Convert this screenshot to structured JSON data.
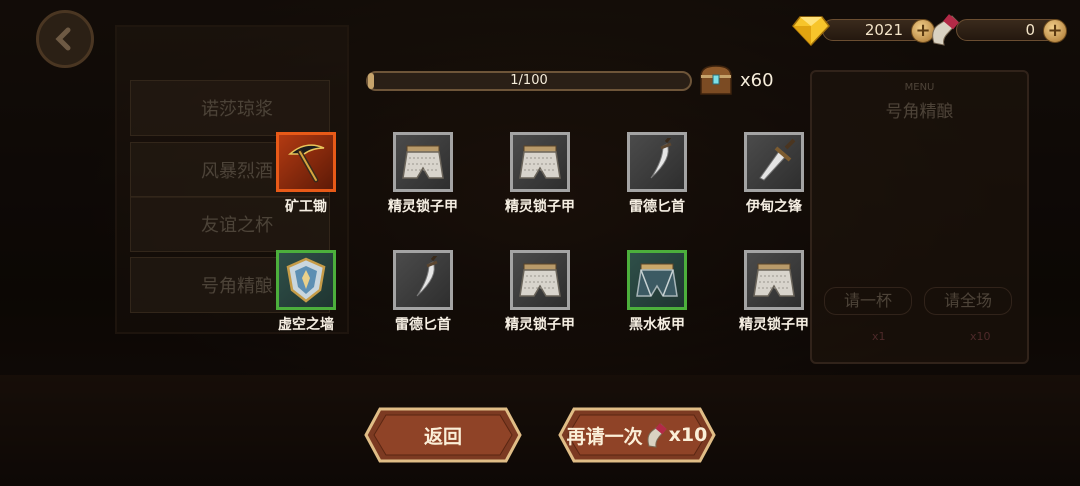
{
  "currency": {
    "gems": {
      "icon": "diamond-icon",
      "value": "2021"
    },
    "horns": {
      "icon": "horn-icon",
      "value": "0"
    }
  },
  "progress": {
    "text": "1/100",
    "fraction": 0.01
  },
  "chest": {
    "icon": "treasure-chest-icon",
    "count": "x60"
  },
  "items": [
    {
      "name": "矿工锄",
      "icon": "pickaxe-icon",
      "rarity": "orange"
    },
    {
      "name": "精灵锁子甲",
      "icon": "chainmail-skirt-icon",
      "rarity": "grey"
    },
    {
      "name": "精灵锁子甲",
      "icon": "chainmail-skirt-icon",
      "rarity": "grey"
    },
    {
      "name": "雷德匕首",
      "icon": "curved-dagger-icon",
      "rarity": "grey"
    },
    {
      "name": "伊甸之锋",
      "icon": "blade-icon",
      "rarity": "grey"
    },
    {
      "name": "虚空之墙",
      "icon": "shield-icon",
      "rarity": "green"
    },
    {
      "name": "雷德匕首",
      "icon": "curved-dagger-icon",
      "rarity": "grey"
    },
    {
      "name": "精灵锁子甲",
      "icon": "chainmail-skirt-icon",
      "rarity": "grey"
    },
    {
      "name": "黑水板甲",
      "icon": "plate-skirt-icon",
      "rarity": "green"
    },
    {
      "name": "精灵锁子甲",
      "icon": "chainmail-skirt-icon",
      "rarity": "grey"
    }
  ],
  "buttons": {
    "back": "返回",
    "again": "再请一次",
    "again_cost": "x10",
    "again_icon": "horn-icon"
  },
  "background": {
    "menu_items": [
      "诺莎琼浆",
      "风暴烈酒",
      "友谊之杯",
      "号角精酿"
    ],
    "panel_title": "号角精酿",
    "panel_menu": "MENU",
    "panel_btn_one": "请一杯",
    "panel_btn_all": "请全场",
    "panel_cost_one": "x1",
    "panel_cost_all": "x10"
  },
  "colors": {
    "accent": "#c7a46c",
    "orange_frame": "#e85a18",
    "green_frame": "#4caf3c",
    "grey_frame": "#a4a4a4"
  }
}
